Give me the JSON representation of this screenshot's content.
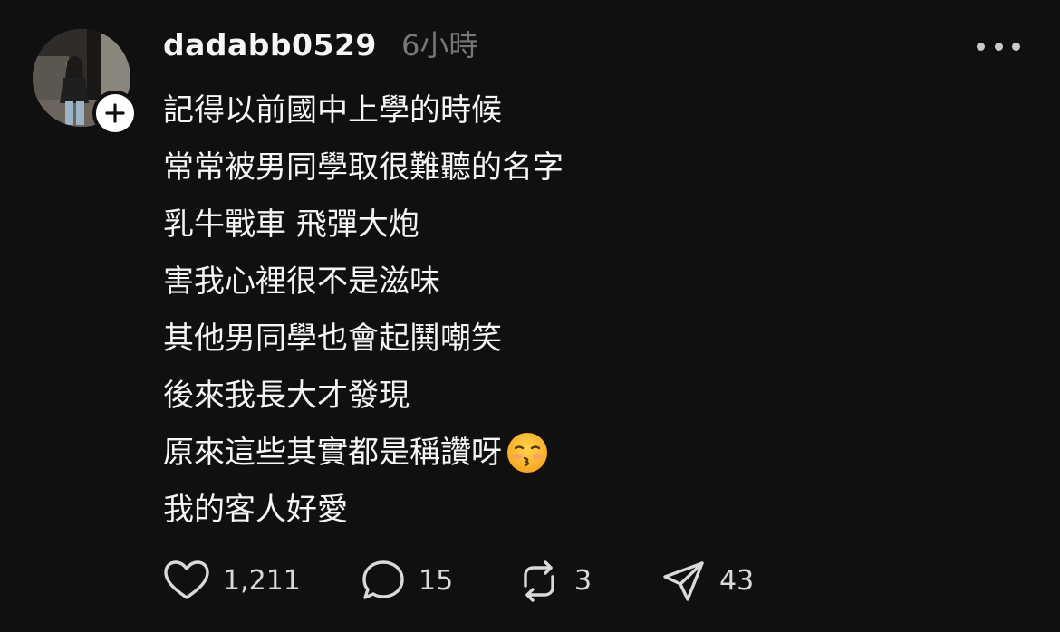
{
  "post": {
    "username": "dadabb0529",
    "timestamp": "6小時",
    "lines": [
      "記得以前國中上學的時候",
      "常常被男同學取很難聽的名字",
      "乳牛戰車 飛彈大炮",
      "害我心裡很不是滋味",
      "其他男同學也會起鬨嘲笑",
      "後來我長大才發現",
      "原來這些其實都是稱讚呀",
      "我的客人好愛"
    ],
    "trailing_emoji_line_index": 6,
    "trailing_emoji": "kissing-face-with-closed-eyes-emoji"
  },
  "actions": {
    "likes": "1,211",
    "replies": "15",
    "reposts": "3",
    "shares": "43"
  },
  "icons": {
    "follow": "plus-icon",
    "more": "more-horizontal-icon",
    "like": "heart-icon",
    "reply": "speech-bubble-icon",
    "repost": "repost-icon",
    "share": "send-icon"
  },
  "colors": {
    "background": "#101010",
    "text_primary": "#f3f5f7",
    "text_secondary": "#777777",
    "icon": "#d9d9d9"
  }
}
